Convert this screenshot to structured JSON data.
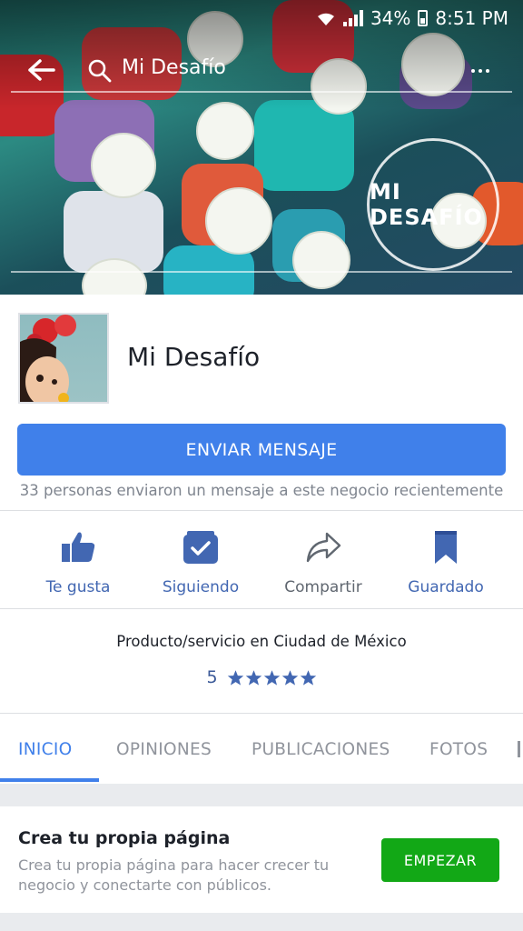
{
  "status": {
    "battery": "34%",
    "time": "8:51 PM"
  },
  "header": {
    "search_text": "Mi Desafío"
  },
  "cover": {
    "watermark_text": "MI DESAFÍO"
  },
  "page": {
    "name": "Mi Desafío",
    "category": "Producto/servicio en Ciudad de México",
    "rating": "5",
    "stars": 5
  },
  "message": {
    "button_label": "ENVIAR MENSAJE",
    "note": "33 personas enviaron un mensaje a este negocio recientemente"
  },
  "actions": [
    {
      "label": "Te gusta",
      "icon": "thumbs-up-icon"
    },
    {
      "label": "Siguiendo",
      "icon": "following-check-icon"
    },
    {
      "label": "Compartir",
      "icon": "share-icon"
    },
    {
      "label": "Guardado",
      "icon": "bookmark-icon"
    }
  ],
  "tabs": [
    {
      "label": "INICIO",
      "active": true
    },
    {
      "label": "OPINIONES",
      "active": false
    },
    {
      "label": "PUBLICACIONES",
      "active": false
    },
    {
      "label": "FOTOS",
      "active": false
    }
  ],
  "promo": {
    "title": "Crea tu propia página",
    "body": "Crea tu propia página para hacer crecer tu negocio y conectarte con públicos.",
    "button_label": "EMPEZAR"
  },
  "colors": {
    "accent": "#4080ea",
    "facebook_blue": "#4267b2",
    "cta_green": "#12a816"
  }
}
